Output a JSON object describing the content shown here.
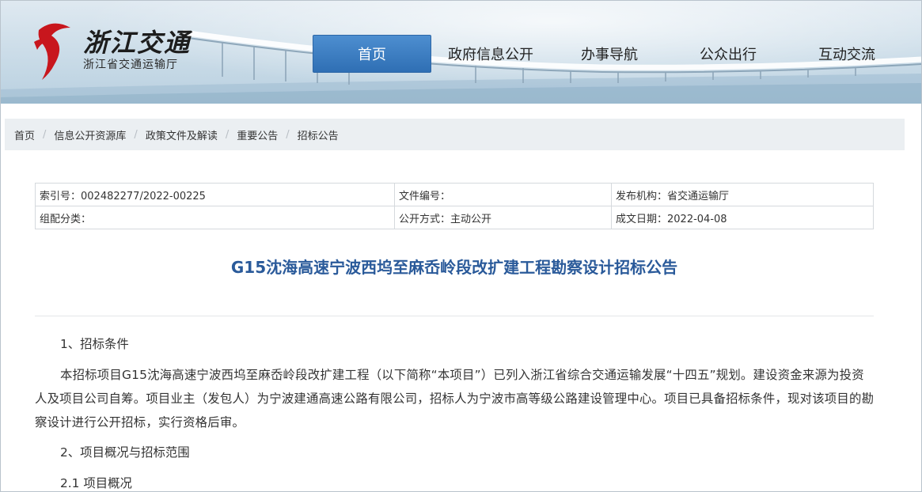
{
  "colors": {
    "nav_active": "#3478c0",
    "title": "#2a5a9a",
    "breadcrumb_bg": "#ebeff2"
  },
  "logo": {
    "icon": "zhejiang-transport-logo-icon",
    "name": "浙江交通",
    "subtitle": "浙江省交通运输厅"
  },
  "nav": [
    {
      "label": "首页",
      "active": true
    },
    {
      "label": "政府信息公开",
      "active": false
    },
    {
      "label": "办事导航",
      "active": false
    },
    {
      "label": "公众出行",
      "active": false
    },
    {
      "label": "互动交流",
      "active": false
    }
  ],
  "breadcrumb": [
    "首页",
    "信息公开资源库",
    "政策文件及解读",
    "重要公告",
    "招标公告"
  ],
  "meta": {
    "index_no": "索引号：002482277/2022-00225",
    "doc_no": "文件编号：",
    "publisher": "发布机构：省交通运输厅",
    "category": "组配分类：",
    "disclosure": "公开方式：主动公开",
    "date": "成文日期：2022-04-08"
  },
  "article": {
    "title": "G15沈海高速宁波西坞至麻岙岭段改扩建工程勘察设计招标公告",
    "heading1": "1、招标条件",
    "para1": "本招标项目G15沈海高速宁波西坞至麻岙岭段改扩建工程（以下简称“本项目”）已列入浙江省综合交通运输发展“十四五”规划。建设资金来源为投资人及项目公司自筹。项目业主（发包人）为宁波建通高速公路有限公司，招标人为宁波市高等级公路建设管理中心。项目已具备招标条件，现对该项目的勘察设计进行公开招标，实行资格后审。",
    "heading2": "2、项目概况与招标范围",
    "heading3": "2.1 项目概况"
  }
}
